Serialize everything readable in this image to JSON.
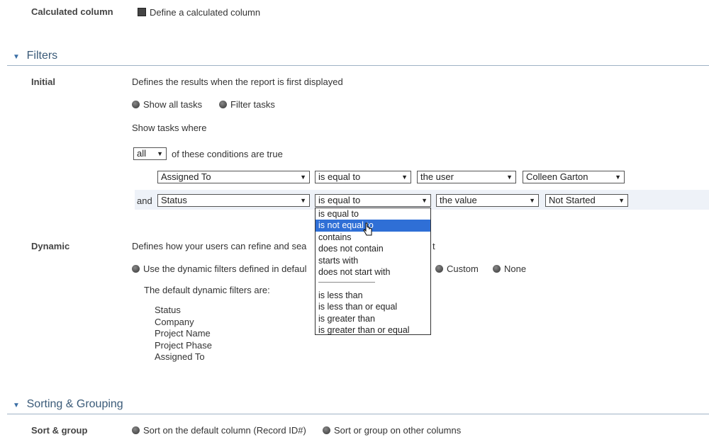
{
  "calculated": {
    "label": "Calculated column",
    "checkbox_label": "Define a calculated column"
  },
  "filters": {
    "title": "Filters",
    "initial": {
      "label": "Initial",
      "description": "Defines the results when the report is first displayed",
      "radio_show_all": "Show all tasks",
      "radio_filter": "Filter tasks",
      "show_where": "Show tasks where",
      "match_select": "all",
      "conditions_text": "of these conditions are true",
      "rows": [
        {
          "conj": "",
          "field": "Assigned To",
          "op": "is equal to",
          "kind": "the user",
          "value": "Colleen Garton"
        },
        {
          "conj": "and",
          "field": "Status",
          "op": "is equal to",
          "kind": "the value",
          "value": "Not Started"
        }
      ],
      "op_options": [
        "is equal to",
        "is not equal to",
        "contains",
        "does not contain",
        "starts with",
        "does not start with",
        "————————",
        "is less than",
        "is less than or equal",
        "is greater than",
        "is greater than or equal"
      ]
    },
    "dynamic": {
      "label": "Dynamic",
      "description_start": "Defines how your users can refine and sea",
      "description_end": "t",
      "radio_default": "Use the dynamic filters defined in defaul",
      "radio_custom": "Custom",
      "radio_none": "None",
      "default_text": "The default dynamic filters are:",
      "list": [
        "Status",
        "Company",
        "Project Name",
        "Project Phase",
        "Assigned To"
      ]
    }
  },
  "sorting": {
    "title": "Sorting & Grouping",
    "label": "Sort & group",
    "radio_default": "Sort on the default column (Record ID#)",
    "radio_other": "Sort or group on other columns"
  }
}
